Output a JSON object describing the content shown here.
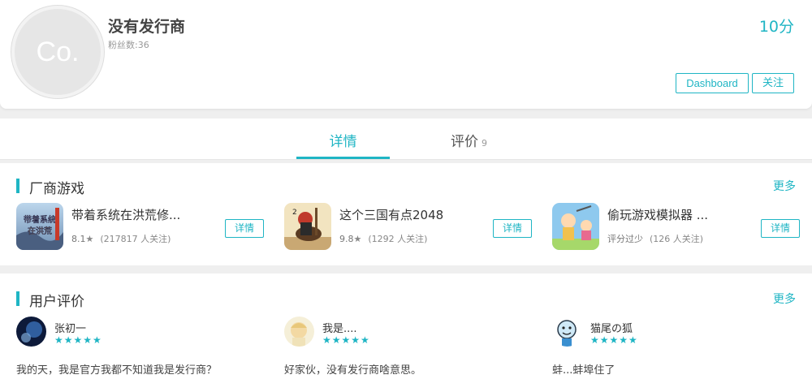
{
  "publisher": {
    "avatar_text": "Co.",
    "name": "没有发行商",
    "fans": "粉丝数:36",
    "score": "10分",
    "dashboard_label": "Dashboard",
    "follow_label": "关注"
  },
  "tabs": [
    {
      "label": "详情",
      "active": true
    },
    {
      "label": "评价",
      "count": "9"
    }
  ],
  "games_section": {
    "title": "厂商游戏",
    "more": "更多",
    "items": [
      {
        "name": "带着系统在洪荒修...",
        "rating": "8.1",
        "star": "★",
        "followers": "(217817 人关注)",
        "button": "详情"
      },
      {
        "name": "这个三国有点2048",
        "rating": "9.8",
        "star": "★",
        "followers": "(1292 人关注)",
        "button": "详情"
      },
      {
        "name": "偷玩游戏模拟器 ...",
        "rating": "评分过少",
        "star": "",
        "followers": "(126 人关注)",
        "button": "详情"
      }
    ]
  },
  "reviews_section": {
    "title": "用户评价",
    "more": "更多",
    "items": [
      {
        "user": "张初一",
        "stars": "★★★★★",
        "text": "我的天，我是官方我都不知道我是发行商？"
      },
      {
        "user": "我是....",
        "stars": "★★★★★",
        "text": "好家伙，没有发行商啥意思。"
      },
      {
        "user": "猫尾の狐",
        "stars": "★★★★★",
        "text": "蚌...蚌埠住了"
      }
    ]
  },
  "colors": {
    "accent": "#1fb5c4",
    "background": "#efefef"
  }
}
